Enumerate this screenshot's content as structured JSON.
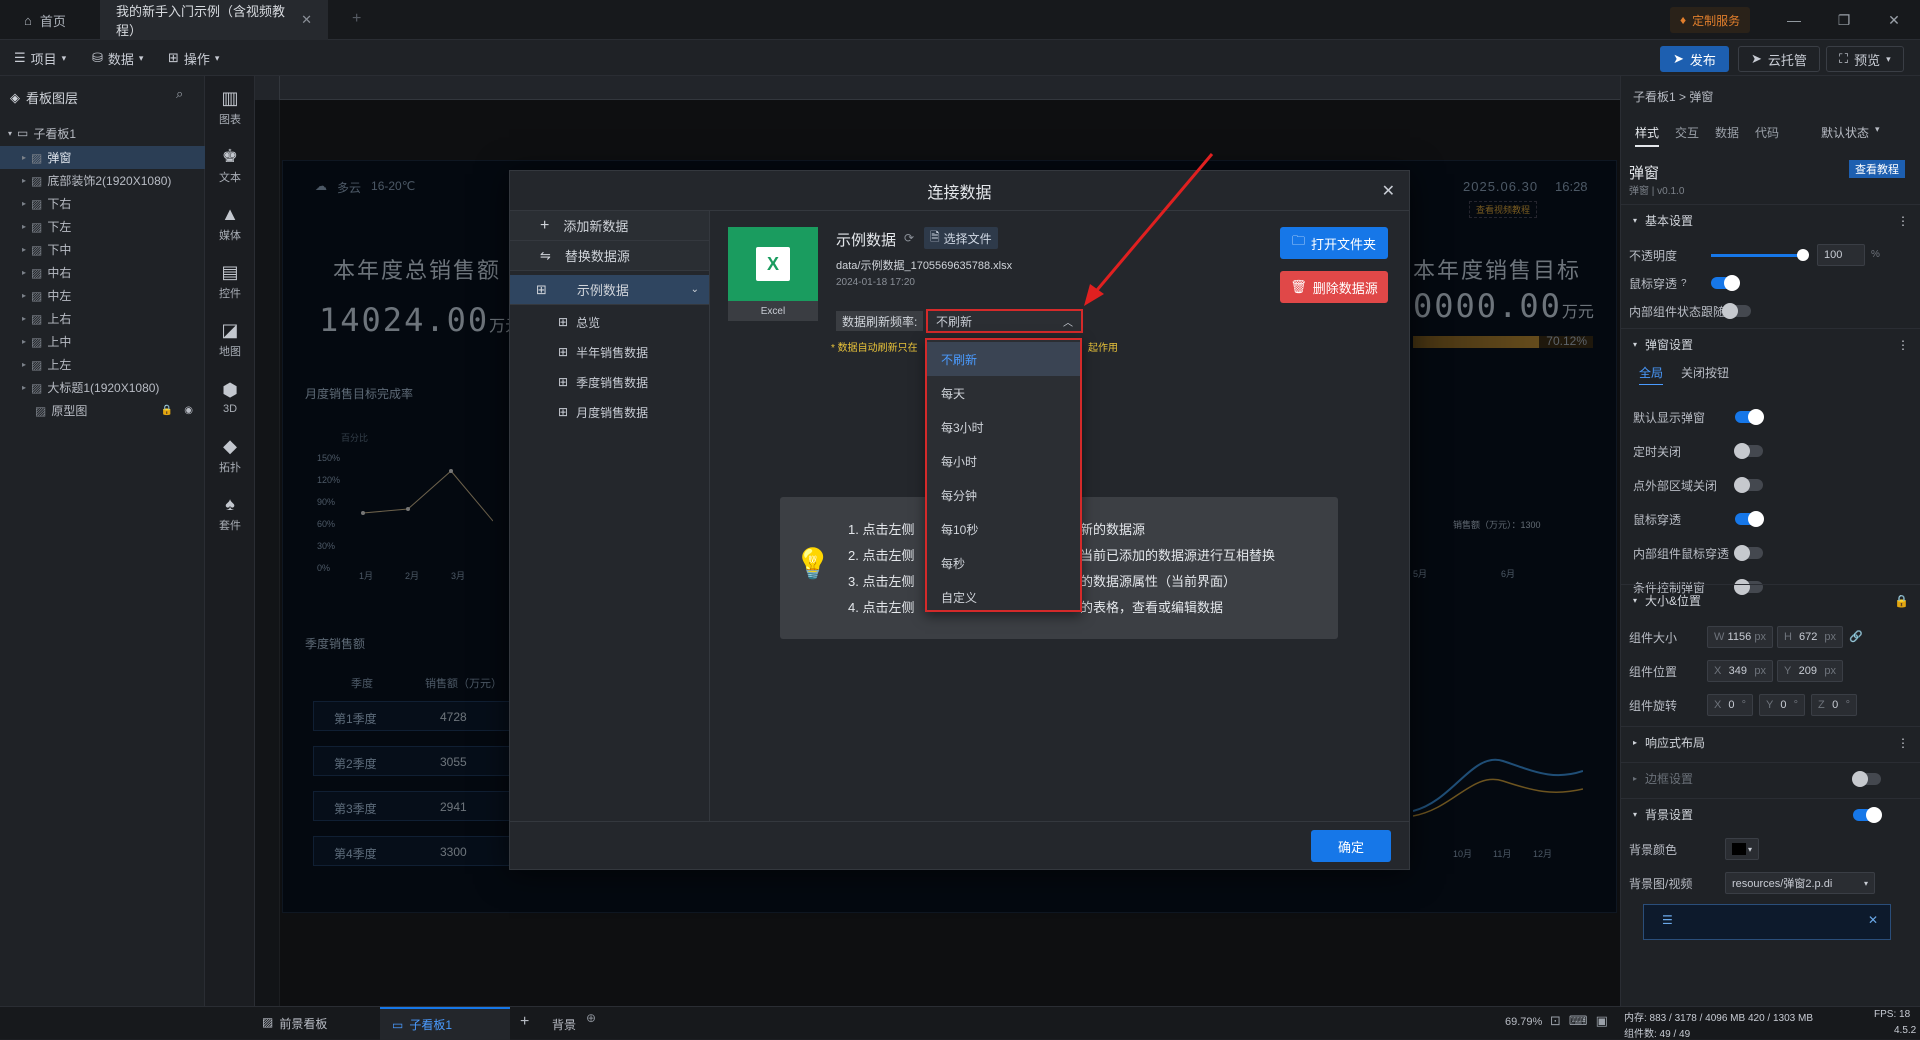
{
  "titlebar": {
    "home_tab": "首页",
    "doc_tab": "我的新手入门示例（含视频教程）",
    "custom_service": "定制服务"
  },
  "toolbar": {
    "project": "项目",
    "data": "数据",
    "operate": "操作",
    "publish": "发布",
    "cloud_hosting": "云托管",
    "preview": "预览"
  },
  "layers": {
    "title": "看板图层",
    "root": "子看板1",
    "items": [
      "弹窗",
      "底部装饰2(1920X1080)",
      "下右",
      "下左",
      "下中",
      "中右",
      "中左",
      "上右",
      "上中",
      "上左",
      "大标题1(1920X1080)",
      "原型图"
    ]
  },
  "iconbar": [
    "图表",
    "文本",
    "媒体",
    "控件",
    "地图",
    "3D",
    "拓扑",
    "套件"
  ],
  "dashboard": {
    "weather": "多云",
    "temp": "16-20℃",
    "date": "2025.06.30",
    "time": "16:28",
    "video_link": "查看视频教程",
    "left_title": "本年度总销售额",
    "left_value": "14024.00",
    "left_unit": "万元",
    "right_title": "本年度销售目标",
    "right_value": "0000.00",
    "right_unit": "万元",
    "right_percent": "70.12%",
    "line_title": "月度销售目标完成率",
    "line_axis_label": "百分比",
    "y_ticks": [
      "150%",
      "120%",
      "90%",
      "60%",
      "30%",
      "0%"
    ],
    "x_ticks": [
      "1月",
      "2月",
      "3月"
    ],
    "right_x_ticks": [
      "5月",
      "6月"
    ],
    "bottom_right_x_ticks": [
      "10月",
      "11月",
      "12月"
    ],
    "legend": "销售额（万元）：1300",
    "table_title": "季度销售额",
    "table_head": [
      "季度",
      "销售额（万元）"
    ],
    "table_rows": [
      [
        "第1季度",
        "4728"
      ],
      [
        "第2季度",
        "3055"
      ],
      [
        "第3季度",
        "2941"
      ],
      [
        "第4季度",
        "3300"
      ]
    ]
  },
  "modal": {
    "title": "连接数据",
    "add_source": "添加新数据",
    "replace_source": "替换数据源",
    "dataset": "示例数据",
    "sheets": [
      "总览",
      "半年销售数据",
      "季度销售数据",
      "月度销售数据"
    ],
    "file_title": "示例数据",
    "choose_file": "选择文件",
    "file_path": "data/示例数据_1705569635788.xlsx",
    "file_date": "2024-01-18 17:20",
    "excel_label": "Excel",
    "refresh_label": "数据刷新频率:",
    "refresh_value": "不刷新",
    "note_start": "* 数据自动刷新只在",
    "note_end": "起作用",
    "open_folder": "打开文件夹",
    "delete_source": "删除数据源",
    "tips": [
      "1. 点击左侧",
      "2. 点击左侧",
      "3. 点击左侧",
      "4. 点击左侧"
    ],
    "tips_tail": [
      "新的数据源",
      "当前已添加的数据源进行互相替换",
      "的数据源属性（当前界面）",
      "的表格，查看或编辑数据"
    ],
    "confirm": "确定",
    "options": [
      "不刷新",
      "每天",
      "每3小时",
      "每小时",
      "每分钟",
      "每10秒",
      "每秒",
      "自定义"
    ]
  },
  "right": {
    "breadcrumb": "子看板1 > 弹窗",
    "tabs": [
      "样式",
      "交互",
      "数据",
      "代码"
    ],
    "state": "默认状态",
    "comp_name": "弹窗",
    "comp_version": "弹窗 | v0.1.0",
    "tutorial": "查看教程",
    "basic": "基本设置",
    "opacity_label": "不透明度",
    "opacity_value": "100",
    "opacity_unit": "%",
    "mouse_through": "鼠标穿透",
    "inner_follow": "内部组件状态跟随",
    "popup_settings": "弹窗设置",
    "sub_tabs": [
      "全局",
      "关闭按钮"
    ],
    "popup_rows": [
      "默认显示弹窗",
      "定时关闭",
      "点外部区域关闭",
      "鼠标穿透",
      "内部组件鼠标穿透",
      "条件控制弹窗"
    ],
    "size_pos": "大小&位置",
    "size_label": "组件大小",
    "w": "1156",
    "h": "672",
    "pos_label": "组件位置",
    "x": "349",
    "y": "209",
    "rot_label": "组件旋转",
    "rx": "0",
    "ry": "0",
    "rz": "0",
    "responsive": "响应式布局",
    "border": "边框设置",
    "bg": "背景设置",
    "bg_color": "背景颜色",
    "bg_media": "背景图/视频",
    "bg_media_value": "resources/弹窗2.p.di"
  },
  "status": {
    "tab1": "前景看板",
    "tab2": "子看板1",
    "bg": "背景",
    "zoom": "69.79%",
    "memory": "内存: 883 / 3178 / 4096 MB  420 / 1303 MB",
    "fps": "FPS: 18",
    "count": "组件数: 49 / 49",
    "version": "4.5.2"
  }
}
